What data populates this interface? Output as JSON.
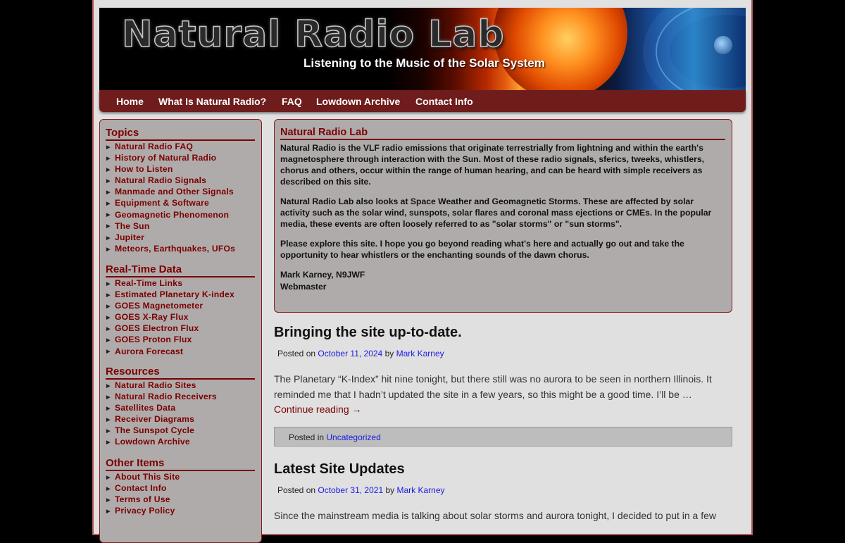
{
  "site": {
    "title": "Natural Radio Lab",
    "tagline": "Listening to the Music of the Solar System"
  },
  "nav": [
    "Home",
    "What Is Natural Radio?",
    "FAQ",
    "Lowdown Archive",
    "Contact Info"
  ],
  "sidebar": {
    "topics": {
      "heading": "Topics",
      "items": [
        "Natural Radio FAQ",
        "History of Natural Radio",
        "How to Listen",
        "Natural Radio Signals",
        "Manmade and Other Signals",
        "Equipment & Software",
        "Geomagnetic Phenomenon",
        "The Sun",
        "Jupiter",
        "Meteors, Earthquakes, UFOs"
      ]
    },
    "realtime": {
      "heading": "Real-Time Data",
      "items": [
        "Real-Time Links",
        "Estimated Planetary K-index",
        "GOES Magnetometer",
        "GOES X-Ray Flux",
        "GOES Electron Flux",
        "GOES Proton Flux",
        "Aurora Forecast"
      ]
    },
    "resources": {
      "heading": "Resources",
      "items": [
        "Natural Radio Sites",
        "Natural Radio Receivers",
        "Satellites Data",
        "Receiver Diagrams",
        "The Sunspot Cycle",
        "Lowdown Archive"
      ]
    },
    "other": {
      "heading": "Other Items",
      "items": [
        "About This Site",
        "Contact Info",
        "Terms of Use",
        "Privacy Policy"
      ]
    }
  },
  "intro": {
    "title": "Natural Radio Lab",
    "p1": "Natural Radio is the VLF radio emissions that originate terrestrially from lightning and within the earth's magnetosphere through interaction with the Sun. Most of these radio signals, sferics, tweeks, whistlers, chorus and others, occur within the range of human hearing, and can be heard with simple receivers as described on this site.",
    "p2": "Natural Radio Lab also looks at Space Weather and Geomagnetic Storms. These are affected by solar activity such as the solar wind, sunspots, solar flares and coronal mass ejections or CMEs. In the popular media, these events are often loosely referred to as \"solar storms\" or \"sun storms\".",
    "p3": "Please explore this site. I hope you go beyond reading what's here and actually go out and take the opportunity to hear whistlers or the enchanting sounds of the dawn chorus.",
    "signature_name": "Mark Karney, N9JWF",
    "signature_role": "Webmaster"
  },
  "posts": [
    {
      "title": "Bringing the site up-to-date.",
      "posted_on_label": "Posted on",
      "date": "October 11, 2024",
      "by_label": "by",
      "author": "Mark Karney",
      "excerpt": "The Planetary “K-Index” hit nine tonight, but there still was no aurora to be seen in northern Illinois. It reminded me that I hadn’t updated the site in a few years, so this might be a good time. I’ll be …",
      "continue": "Continue reading →",
      "posted_in_label": "Posted in",
      "category": "Uncategorized"
    },
    {
      "title": "Latest Site Updates",
      "posted_on_label": "Posted on",
      "date": "October 31, 2021",
      "by_label": "by",
      "author": "Mark Karney",
      "excerpt": "Since the mainstream media is talking about solar storms and aurora tonight, I decided to put in a few"
    }
  ],
  "colors": {
    "accent": "#7b0000",
    "nav_bg": "#6e1c1c",
    "panel_bg": "#b0abab",
    "link": "#1a1ae6"
  }
}
